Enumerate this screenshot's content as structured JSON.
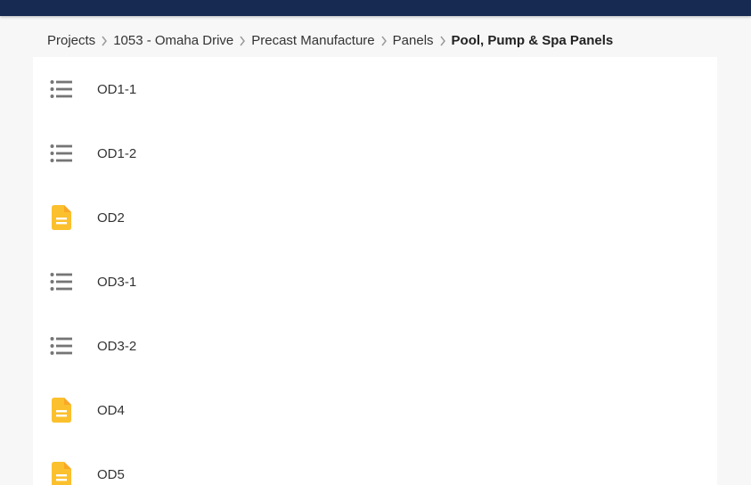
{
  "breadcrumb": [
    {
      "label": "Projects"
    },
    {
      "label": "1053 - Omaha Drive"
    },
    {
      "label": "Precast Manufacture"
    },
    {
      "label": "Panels"
    },
    {
      "label": "Pool, Pump & Spa Panels"
    }
  ],
  "items": [
    {
      "label": "OD1-1",
      "icon": "list-icon"
    },
    {
      "label": "OD1-2",
      "icon": "list-icon"
    },
    {
      "label": "OD2",
      "icon": "document-icon"
    },
    {
      "label": "OD3-1",
      "icon": "list-icon"
    },
    {
      "label": "OD3-2",
      "icon": "list-icon"
    },
    {
      "label": "OD4",
      "icon": "document-icon"
    },
    {
      "label": "OD5",
      "icon": "document-icon"
    }
  ],
  "colors": {
    "topbar": "#172b52",
    "document_icon": "#fbc02d",
    "list_icon": "#757575"
  }
}
